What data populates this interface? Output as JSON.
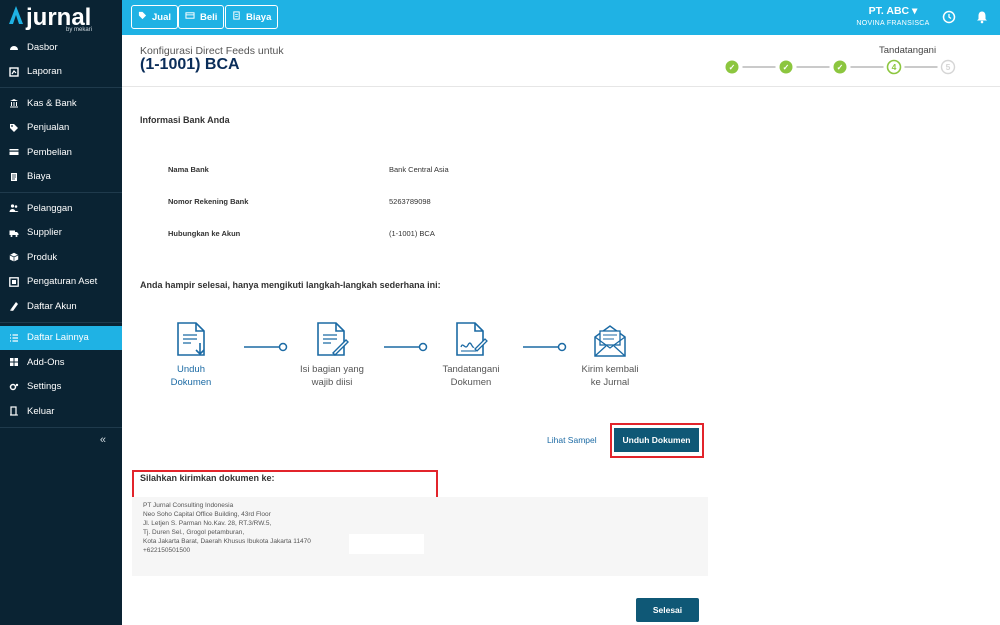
{
  "brand": {
    "name": "jurnal",
    "by": "by mekari"
  },
  "sidebar": {
    "items": [
      {
        "label": "Dasbor",
        "icon": "dashboard-icon"
      },
      {
        "label": "Laporan",
        "icon": "chart-icon"
      },
      {
        "label": "Kas & Bank",
        "icon": "bank-icon"
      },
      {
        "label": "Penjualan",
        "icon": "tag-icon"
      },
      {
        "label": "Pembelian",
        "icon": "card-icon"
      },
      {
        "label": "Biaya",
        "icon": "receipt-icon"
      },
      {
        "label": "Pelanggan",
        "icon": "users-icon"
      },
      {
        "label": "Supplier",
        "icon": "truck-icon"
      },
      {
        "label": "Produk",
        "icon": "box-icon"
      },
      {
        "label": "Pengaturan Aset",
        "icon": "asset-icon"
      },
      {
        "label": "Daftar Akun",
        "icon": "book-icon"
      },
      {
        "label": "Daftar Lainnya",
        "icon": "list-icon"
      },
      {
        "label": "Add-Ons",
        "icon": "addon-icon"
      },
      {
        "label": "Settings",
        "icon": "gear-icon"
      },
      {
        "label": "Keluar",
        "icon": "logout-icon"
      }
    ],
    "collapse_label": "«"
  },
  "topbar": {
    "buttons": [
      {
        "label": "Jual",
        "icon": "tag-icon"
      },
      {
        "label": "Beli",
        "icon": "card-icon"
      },
      {
        "label": "Biaya",
        "icon": "receipt-icon"
      }
    ],
    "company": "PT. ABC ▾",
    "user": "NOVINA FRANSISCA"
  },
  "header": {
    "subtitle": "Konfigurasi Direct Feeds untuk",
    "title": "(1-1001) BCA",
    "current_step_label": "Tandatangani",
    "current_step": 4,
    "total_steps": 5,
    "steps": [
      "✓",
      "✓",
      "✓",
      "4",
      "5"
    ],
    "colors": {
      "done": "#8cc63f",
      "pending": "#d5d5d5"
    }
  },
  "bank_info": {
    "title": "Informasi Bank Anda",
    "rows": [
      {
        "label": "Nama Bank",
        "value": "Bank Central Asia"
      },
      {
        "label": "Nomor Rekening Bank",
        "value": "5263789098"
      },
      {
        "label": "Hubungkan ke Akun",
        "value": "(1-1001) BCA"
      }
    ]
  },
  "instructions": {
    "title": "Anda hampir selesai, hanya mengikuti langkah-langkah sederhana ini:",
    "steps": [
      {
        "line1": "Unduh",
        "line2": "Dokumen",
        "icon": "download-document-icon"
      },
      {
        "line1": "Isi bagian yang",
        "line2": "wajib diisi",
        "icon": "edit-document-icon"
      },
      {
        "line1": "Tandatangani",
        "line2": "Dokumen",
        "icon": "sign-document-icon"
      },
      {
        "line1": "Kirim kembali",
        "line2": "ke Jurnal",
        "icon": "mail-icon"
      }
    ]
  },
  "actions": {
    "sample_link": "Lihat Sampel",
    "download_button": "Unduh Dokumen",
    "finish_button": "Selesai"
  },
  "send_to": {
    "title": "Silahkan kirimkan dokumen ke:",
    "lines": [
      "PT Jurnal Consulting Indonesia",
      "Neo Soho Capital Office Building, 43rd Floor",
      "Jl. Letjen S. Parman No.Kav. 28, RT.3/RW.5,",
      "Tj. Duren Sel., Grogol petamburan,",
      "Kota Jakarta Barat, Daerah Khusus Ibukota Jakarta 11470",
      "+622150501500"
    ]
  },
  "colors": {
    "accent": "#1fb2e4",
    "sidebar": "#0a2333",
    "dark_button": "#0f5876",
    "highlight": "#e2242b"
  }
}
